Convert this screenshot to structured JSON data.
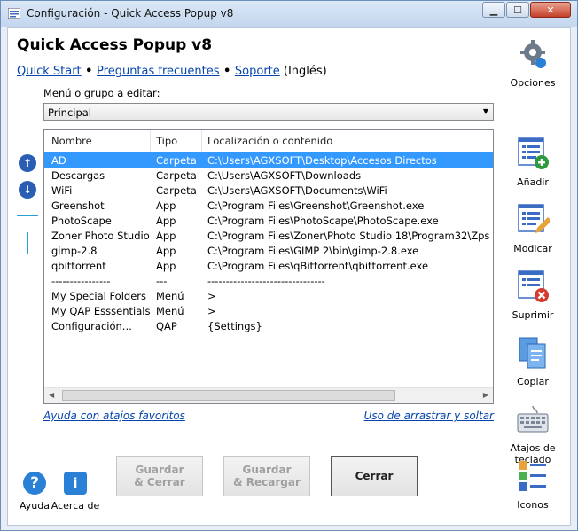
{
  "window": {
    "title": "Configuración - Quick Access Popup v8",
    "minimize_glyph": "▁",
    "maximize_glyph": "☐",
    "close_glyph": "✕"
  },
  "header": {
    "title": "Quick Access Popup v8",
    "links": {
      "quick_start": "Quick Start",
      "sep1": " • ",
      "faq": "Preguntas frecuentes",
      "sep2": " • ",
      "support": "Soporte",
      "lang": " (Inglés)"
    }
  },
  "menu": {
    "label": "Menú o grupo a editar:",
    "selected": "Principal"
  },
  "list": {
    "headers": [
      "Nombre",
      "Tipo",
      "Localización o contenido"
    ],
    "rows": [
      {
        "name": "AD",
        "type": "Carpeta",
        "location": "C:\\Users\\AGXSOFT\\Desktop\\Accesos Directos"
      },
      {
        "name": "Descargas",
        "type": "Carpeta",
        "location": "C:\\Users\\AGXSOFT\\Downloads"
      },
      {
        "name": "WiFi",
        "type": "Carpeta",
        "location": "C:\\Users\\AGXSOFT\\Documents\\WiFi"
      },
      {
        "name": "Greenshot",
        "type": "App",
        "location": "C:\\Program Files\\Greenshot\\Greenshot.exe"
      },
      {
        "name": "PhotoScape",
        "type": "App",
        "location": "C:\\Program Files\\PhotoScape\\PhotoScape.exe"
      },
      {
        "name": "Zoner Photo Studio",
        "type": "App",
        "location": "C:\\Program Files\\Zoner\\Photo Studio 18\\Program32\\Zps"
      },
      {
        "name": "gimp-2.8",
        "type": "App",
        "location": "C:\\Program Files\\GIMP 2\\bin\\gimp-2.8.exe"
      },
      {
        "name": "qbittorrent",
        "type": "App",
        "location": "C:\\Program Files\\qBittorrent\\qbittorrent.exe"
      },
      {
        "name": "----------------",
        "type": "---",
        "location": "--------------------------------"
      },
      {
        "name": "My Special Folders",
        "type": "Menú",
        "location": ">"
      },
      {
        "name": "My QAP Esssentials",
        "type": "Menú",
        "location": ">"
      },
      {
        "name": "Configuración...",
        "type": "QAP",
        "location": "{Settings}"
      }
    ],
    "selected_row": 0
  },
  "help_links": {
    "shortcuts": "Ayuda con atajos favoritos",
    "dragdrop": "Uso de arrastrar y soltar"
  },
  "side": {
    "options": "Opciones",
    "add": "Añadir",
    "modify": "Modicar",
    "delete": "Suprimir",
    "copy": "Copiar",
    "hotkeys": "Atajos de teclado",
    "icons": "Iconos"
  },
  "buttons": {
    "save_close_1": "Guardar",
    "save_close_2": "& Cerrar",
    "save_reload_1": "Guardar",
    "save_reload_2": "& Recargar",
    "close": "Cerrar"
  },
  "bottom": {
    "help": "Ayuda",
    "help_glyph": "?",
    "about": "Acerca de",
    "about_glyph": "i"
  },
  "nav": {
    "up_glyph": "↑",
    "down_glyph": "↓"
  },
  "colors": {
    "accent": "#2a5eb5",
    "selection": "#3399ff",
    "link": "#0645ad"
  },
  "icons": [
    "gear-icon",
    "add-icon",
    "edit-icon",
    "delete-icon",
    "copy-icon",
    "keyboard-icon",
    "icons-icon",
    "help-icon",
    "info-icon",
    "arrow-up-icon",
    "arrow-down-icon"
  ]
}
